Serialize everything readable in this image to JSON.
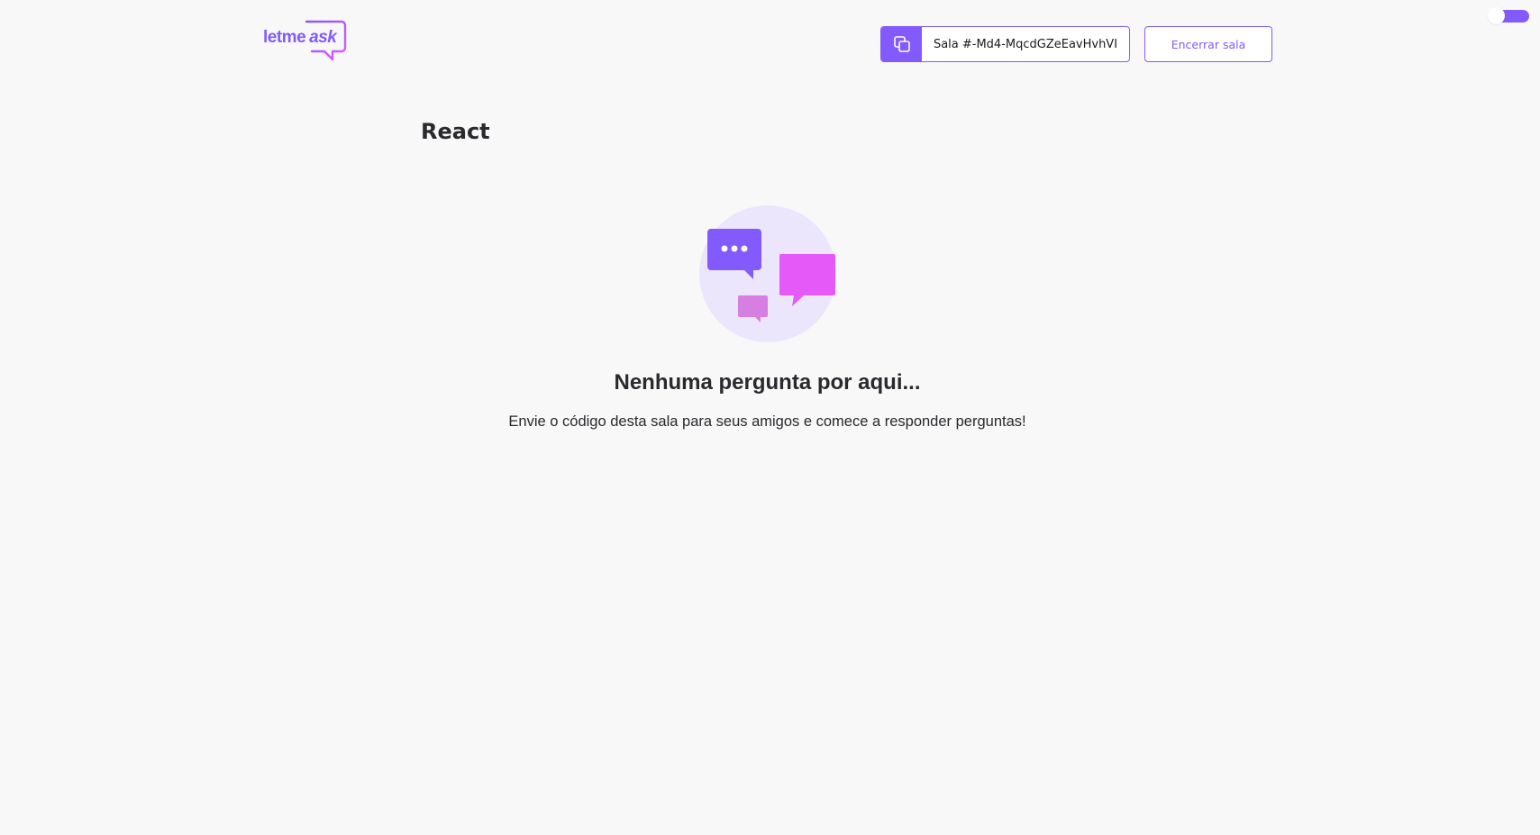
{
  "theme_toggle": {
    "accent": "#835afd"
  },
  "header": {
    "logo": {
      "part1": "letme",
      "part2": "ask"
    },
    "room_code": {
      "label": "Sala #-Md4-MqcdGZeEavHvhVI",
      "icon": "copy-icon"
    },
    "close_room_label": "Encerrar sala"
  },
  "room": {
    "title": "React"
  },
  "empty_state": {
    "illustration": "empty-questions-illustration",
    "title": "Nenhuma pergunta por aqui...",
    "subtitle": "Envie o código desta sala para seus amigos e comece a responder perguntas!"
  },
  "colors": {
    "primary": "#835afd",
    "pink": "#e559f9",
    "background": "#f8f8f8",
    "text": "#29292e"
  }
}
